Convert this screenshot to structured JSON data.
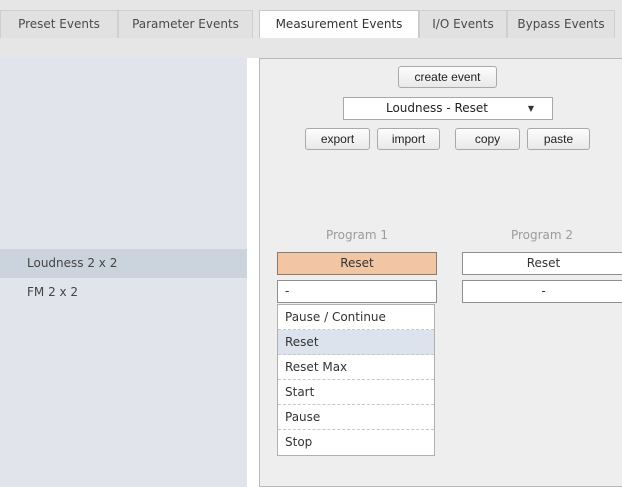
{
  "tabs": [
    {
      "label": "Preset Events",
      "active": false
    },
    {
      "label": "Parameter Events",
      "active": false
    },
    {
      "label": "Measurement Events",
      "active": true
    },
    {
      "label": "I/O Events",
      "active": false
    },
    {
      "label": "Bypass Events",
      "active": false
    }
  ],
  "sidebar": {
    "items": [
      {
        "label": "Loudness 2 x 2",
        "selected": true
      },
      {
        "label": "FM 2 x 2",
        "selected": false
      }
    ]
  },
  "toolbar": {
    "create_event": "create event",
    "event_select": "Loudness - Reset",
    "export": "export",
    "import": "import",
    "copy": "copy",
    "paste": "paste"
  },
  "columns": [
    "Program 1",
    "Program 2"
  ],
  "rows": [
    {
      "cells": [
        "Reset",
        "Reset"
      ]
    },
    {
      "cells": [
        "-",
        "-"
      ]
    }
  ],
  "dropdown": {
    "items": [
      "Pause / Continue",
      "Reset",
      "Reset Max",
      "Start",
      "Pause",
      "Stop"
    ],
    "highlighted": "Reset"
  },
  "colors": {
    "selected_cell": "#f2c6a2",
    "sidebar_bg": "#e1e5eb",
    "sidebar_selected": "#cbd3dd",
    "dropdown_highlight": "#dde3ec"
  }
}
